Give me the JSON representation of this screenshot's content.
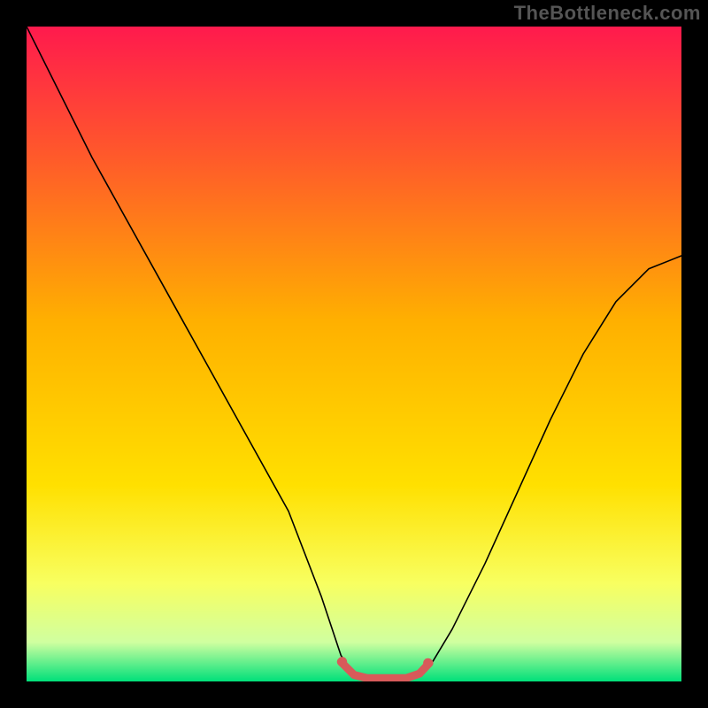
{
  "watermark": "TheBottleneck.com",
  "chart_data": {
    "type": "line",
    "title": "",
    "xlabel": "",
    "ylabel": "",
    "xlim": [
      0,
      100
    ],
    "ylim": [
      0,
      100
    ],
    "gradient_stops": [
      {
        "offset": 0.0,
        "color": "#ff1a4d"
      },
      {
        "offset": 0.2,
        "color": "#ff5a2a"
      },
      {
        "offset": 0.45,
        "color": "#ffb000"
      },
      {
        "offset": 0.7,
        "color": "#ffe000"
      },
      {
        "offset": 0.85,
        "color": "#f8ff60"
      },
      {
        "offset": 0.94,
        "color": "#d0ffa0"
      },
      {
        "offset": 1.0,
        "color": "#00e07a"
      }
    ],
    "series": [
      {
        "name": "bottleneck-curve",
        "x": [
          0,
          5,
          10,
          15,
          20,
          25,
          30,
          35,
          40,
          45,
          48,
          50,
          52,
          54,
          56,
          58,
          60,
          62,
          65,
          70,
          75,
          80,
          85,
          90,
          95,
          100
        ],
        "y": [
          100,
          90,
          80,
          71,
          62,
          53,
          44,
          35,
          26,
          13,
          4,
          1,
          0,
          0,
          0,
          0,
          1,
          3,
          8,
          18,
          29,
          40,
          50,
          58,
          63,
          65
        ],
        "color": "#000000",
        "line_width": 1.6
      },
      {
        "name": "optimal-range-highlight",
        "x": [
          48,
          50,
          52,
          54,
          56,
          58,
          60,
          61.5
        ],
        "y": [
          3.0,
          1.0,
          0.5,
          0.5,
          0.5,
          0.5,
          1.2,
          2.8
        ],
        "color": "#d85a5a",
        "line_width": 9
      }
    ],
    "optimal_range_markers": [
      {
        "x": 48.2,
        "y": 3.0
      },
      {
        "x": 61.3,
        "y": 2.8
      }
    ]
  }
}
